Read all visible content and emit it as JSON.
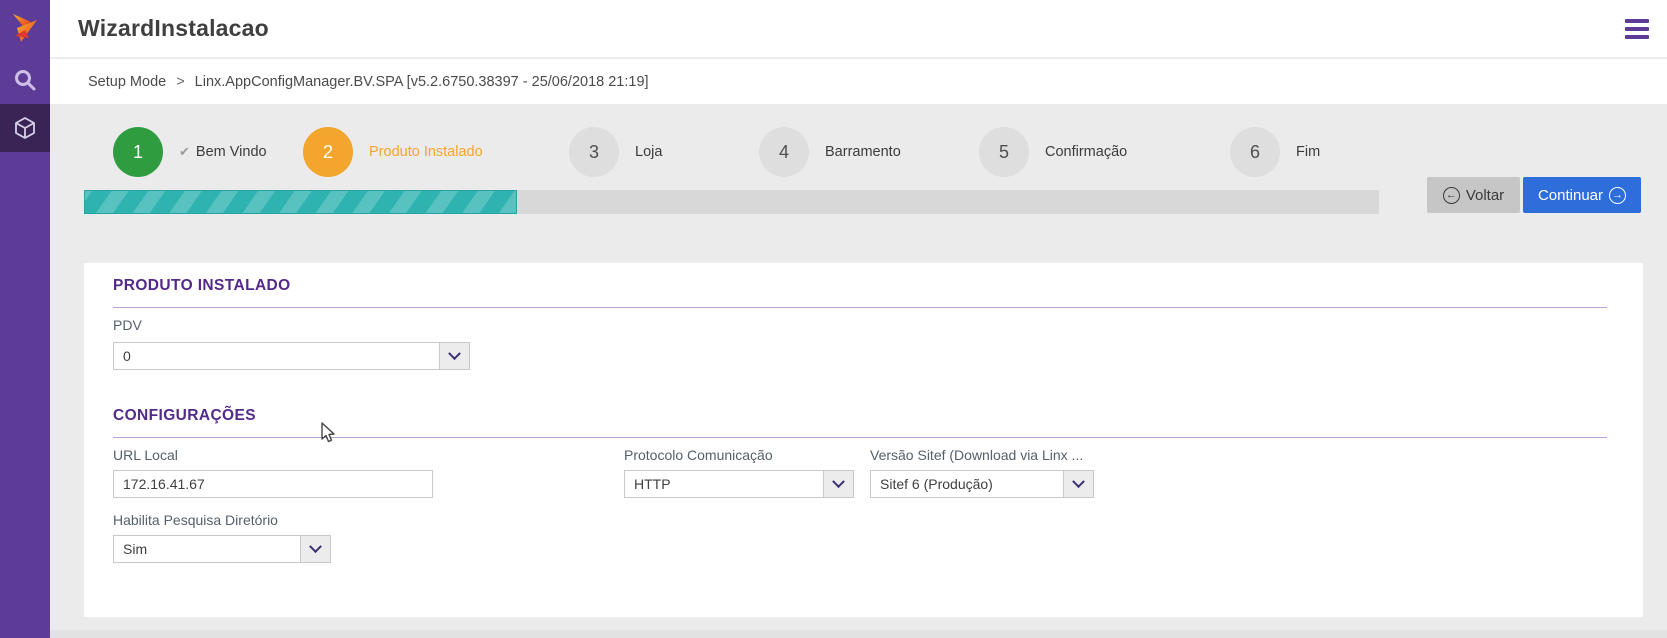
{
  "app": {
    "title": "WizardInstalacao"
  },
  "header": {
    "menu_icon": "hamburger-icon"
  },
  "sidebar": {
    "logo_icon": "linx-logo",
    "items": [
      {
        "icon": "search-icon",
        "active": false
      },
      {
        "icon": "package-icon",
        "active": true
      }
    ]
  },
  "breadcrumb": {
    "separator": ">",
    "items": [
      "Setup Mode",
      "Linx.AppConfigManager.BV.SPA [v5.2.6750.38397 - 25/06/2018 21:19]"
    ]
  },
  "stepper": {
    "steps": [
      {
        "number": "1",
        "label": "Bem Vindo",
        "state": "done",
        "check_icon": "✔"
      },
      {
        "number": "2",
        "label": "Produto Instalado",
        "state": "active"
      },
      {
        "number": "3",
        "label": "Loja",
        "state": "todo"
      },
      {
        "number": "4",
        "label": "Barramento",
        "state": "todo"
      },
      {
        "number": "5",
        "label": "Confirmação",
        "state": "todo"
      },
      {
        "number": "6",
        "label": "Fim",
        "state": "todo"
      }
    ]
  },
  "progress": {
    "percent": 33.4
  },
  "actions": {
    "back_label": "Voltar",
    "back_arrow": "←",
    "continue_label": "Continuar",
    "continue_arrow": "→"
  },
  "sections": {
    "produto": {
      "title": "PRODUTO INSTALADO"
    },
    "configuracoes": {
      "title": "CONFIGURAÇÕES"
    }
  },
  "form": {
    "pdv": {
      "label": "PDV",
      "value": "0"
    },
    "url_local": {
      "label": "URL Local",
      "value": "172.16.41.67"
    },
    "protocolo": {
      "label": "Protocolo Comunicação",
      "value": "HTTP"
    },
    "versao_sitef": {
      "label": "Versão Sitef (Download via Linx ...",
      "value": "Sitef 6 (Produção)"
    },
    "habilita_pesquisa": {
      "label": "Habilita Pesquisa Diretório",
      "value": "Sim"
    }
  },
  "colors": {
    "sidebar_purple": "#5c3c97",
    "sidebar_active": "#3a2456",
    "accent_purple": "#53298a",
    "step_done_green": "#2f9c3f",
    "step_active_orange": "#f3a52e",
    "progress_teal": "#2fb3b1",
    "continue_blue": "#2e6edb",
    "page_background": "#ebebeb"
  }
}
